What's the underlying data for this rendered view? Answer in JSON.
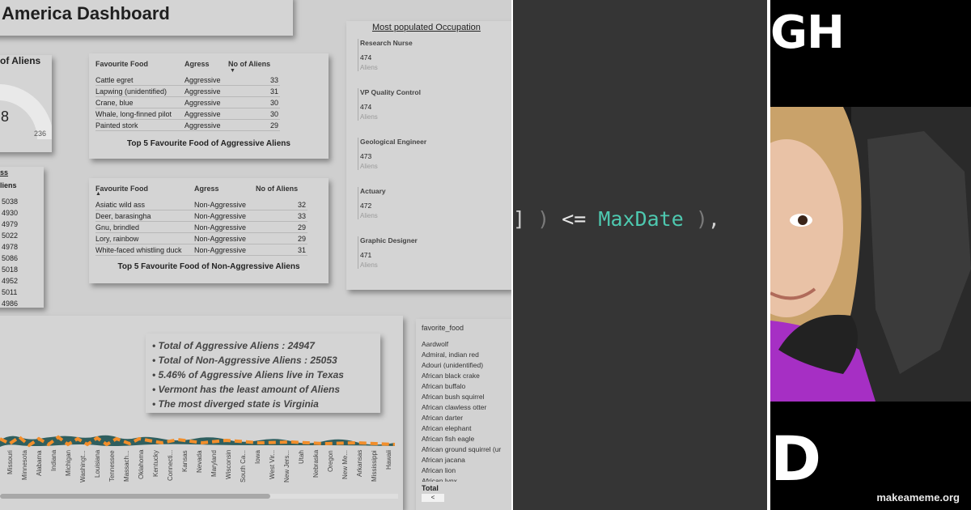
{
  "dashboard": {
    "title": "America Dashboard",
    "gauge": {
      "title": "of Aliens",
      "value": "8",
      "max": "236"
    },
    "states": {
      "header1": "ss",
      "header2": "liens",
      "values": [
        "5038",
        "4930",
        "4979",
        "5022",
        "4978",
        "5086",
        "5018",
        "4952",
        "5011",
        "4986"
      ]
    },
    "aggressive_table": {
      "headers": [
        "Favourite Food",
        "Agress",
        "No of Aliens"
      ],
      "rows": [
        {
          "food": "Cattle egret",
          "agress": "Aggressive",
          "count": "33"
        },
        {
          "food": "Lapwing (unidentified)",
          "agress": "Aggressive",
          "count": "31"
        },
        {
          "food": "Crane, blue",
          "agress": "Aggressive",
          "count": "30"
        },
        {
          "food": "Whale, long-finned pilot",
          "agress": "Aggressive",
          "count": "30"
        },
        {
          "food": "Painted stork",
          "agress": "Aggressive",
          "count": "29"
        }
      ],
      "caption": "Top 5 Favourite Food of Aggressive Aliens"
    },
    "non_aggressive_table": {
      "headers": [
        "Favourite Food",
        "Agress",
        "No of Aliens"
      ],
      "rows": [
        {
          "food": "Asiatic wild ass",
          "agress": "Non-Aggressive",
          "count": "32"
        },
        {
          "food": "Deer, barasingha",
          "agress": "Non-Aggressive",
          "count": "33"
        },
        {
          "food": "Gnu, brindled",
          "agress": "Non-Aggressive",
          "count": "29"
        },
        {
          "food": "Lory, rainbow",
          "agress": "Non-Aggressive",
          "count": "29"
        },
        {
          "food": "White-faced whistling duck",
          "agress": "Non-Aggressive",
          "count": "31"
        }
      ],
      "caption": "Top 5 Favourite Food of Non-Aggressive Aliens"
    },
    "occupation": {
      "title": "Most populated Occupation",
      "unit": "Aliens",
      "items": [
        {
          "name": "Research Nurse",
          "value": "474"
        },
        {
          "name": "VP Quality Control",
          "value": "474"
        },
        {
          "name": "Geological Engineer",
          "value": "473"
        },
        {
          "name": "Actuary",
          "value": "472"
        },
        {
          "name": "Graphic Designer",
          "value": "471"
        }
      ]
    },
    "facts": [
      "• Total of Aggressive Aliens : 24947",
      "• Total of Non-Aggressive Aliens :  25053",
      "• 5.46% of Aggressive Aliens live in Texas",
      "• Vermont has the least amount of Aliens",
      "• The most diverged state is Virginia"
    ],
    "ribbon_chart": {
      "colors": {
        "aggressive": "#f28e2b",
        "non_aggressive": "#2f5f5f"
      },
      "states": [
        "Missouri",
        "Minnesota",
        "Alabama",
        "Indiana",
        "Michigan",
        "Washingt...",
        "Louisiana",
        "Tennessee",
        "Massach...",
        "Oklahoma",
        "Kentucky",
        "Connecti...",
        "Kansas",
        "Nevada",
        "Maryland",
        "Wisconsin",
        "South Ca...",
        "Iowa",
        "West Vir...",
        "New Jers...",
        "Utah",
        "Nebraska",
        "Oregon",
        "New Me...",
        "Arkansas",
        "Mississippi",
        "Hawaii"
      ]
    },
    "food_list": {
      "header": "favorite_food",
      "items": [
        "Aardwolf",
        "Admiral, indian red",
        "Adouri (unidentified)",
        "African black crake",
        "African buffalo",
        "African bush squirrel",
        "African clawless otter",
        "African darter",
        "African elephant",
        "African fish eagle",
        "African ground squirrel (ur",
        "African jacana",
        "African lion",
        "African lynx"
      ],
      "total_label": "Total",
      "scroll_left": "<"
    }
  },
  "code": {
    "bracket": "]",
    "paren_open": ")",
    "operator": "<=",
    "identifier": "MaxDate",
    "paren_close": ")",
    "comma": ","
  },
  "meme": {
    "top_caption": "GH",
    "bottom_caption": "D",
    "watermark": "makeameme.org"
  }
}
